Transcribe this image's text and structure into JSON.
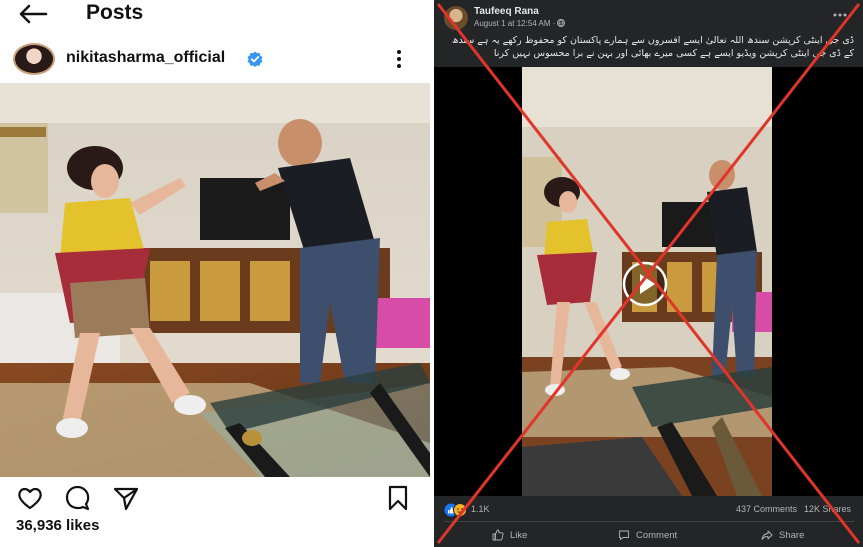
{
  "colors": {
    "fb_bg": "#242526",
    "x_mark": "#e0352b",
    "ig_verified": "#3897f0",
    "fb_like_blue": "#1877f2"
  },
  "instagram": {
    "title": "Posts",
    "username": "nikitasharma_official",
    "likes": "36,936 likes",
    "icons": [
      "back-arrow-icon",
      "verified-badge-icon",
      "more-vertical-icon",
      "heart-icon",
      "comment-icon",
      "share-icon",
      "bookmark-icon"
    ]
  },
  "facebook": {
    "author": "Taufeeq Rana",
    "time": "August 1 at 12:54 AM ·",
    "caption": "ڈی جی اینٹی کرپشن سندھ اللہ تعالیٰ ایسے افسروں سے ہمارے پاکستان کو محفوظ رکھے یہ ہے سندھ کے ڈی جی اینٹی کرپشن ویڈیو ایسے ہے کسی میرے بھائی اور بہن نے برا محسوس نہیں کرنا",
    "reactions": "1.1K",
    "comments": "437 Comments",
    "shares": "12K Shares",
    "like_label": "Like",
    "comment_label": "Comment",
    "share_label": "Share"
  }
}
